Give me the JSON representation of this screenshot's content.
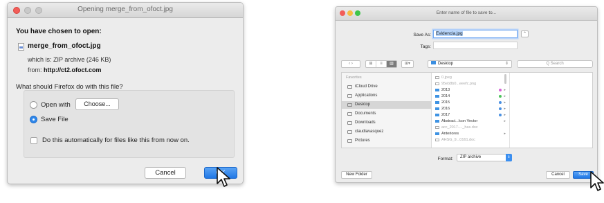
{
  "firefox_dialog": {
    "title": "Opening merge_from_ofoct.jpg",
    "heading": "You have chosen to open:",
    "file_name": "merge_from_ofoct.jpg",
    "which_is": "which is: ZIP archive (246 KB)",
    "from_prefix": "from: ",
    "from_url": "http://ct2.ofoct.com",
    "question": "What should Firefox do with this file?",
    "open_with_label": "Open with",
    "choose_label": "Choose...",
    "save_file_label": "Save File",
    "save_file_selected": true,
    "auto_label": "Do this automatically for files like this from now on.",
    "auto_checked": false,
    "cancel_label": "Cancel",
    "ok_label": "OK"
  },
  "save_dialog": {
    "title": "Enter name of file to save to...",
    "save_as_label": "Save As:",
    "save_as_value": "Evidencia.jpg",
    "tags_label": "Tags:",
    "expand_glyph": "⌃",
    "nav_glyph": "‹ ›",
    "view_glyphs": [
      "⊞",
      "≡",
      "▥"
    ],
    "arrange_glyph": "⊞▾",
    "location": "Desktop",
    "search_placeholder": "Q Search",
    "sidebar_heading": "Favorites",
    "sidebar_items": [
      {
        "label": "iCloud Drive",
        "selected": false
      },
      {
        "label": "Applications",
        "selected": false
      },
      {
        "label": "Desktop",
        "selected": true
      },
      {
        "label": "Documents",
        "selected": false
      },
      {
        "label": "Downloads",
        "selected": false
      },
      {
        "label": "claudiavasquez",
        "selected": false
      },
      {
        "label": "Pictures",
        "selected": false
      }
    ],
    "files": [
      {
        "name": "0.jpeg",
        "kind": "doc",
        "dim": true,
        "tag": "",
        "arrow": false
      },
      {
        "name": "95eb8b0...eeefc.png",
        "kind": "doc",
        "dim": true,
        "tag": "",
        "arrow": false
      },
      {
        "name": "2013",
        "kind": "folder",
        "dim": false,
        "tag": "#d861d8",
        "arrow": true
      },
      {
        "name": "2014",
        "kind": "folder",
        "dim": false,
        "tag": "#4bc25a",
        "arrow": true
      },
      {
        "name": "2015",
        "kind": "folder",
        "dim": false,
        "tag": "#4a90e2",
        "arrow": true
      },
      {
        "name": "2016",
        "kind": "folder",
        "dim": false,
        "tag": "#4a90e2",
        "arrow": true
      },
      {
        "name": "2017",
        "kind": "folder",
        "dim": false,
        "tag": "#4a90e2",
        "arrow": true
      },
      {
        "name": "Abstract...Icon Vector",
        "kind": "folder",
        "dim": false,
        "tag": "",
        "arrow": true
      },
      {
        "name": "acc_2017-..._has.doc",
        "kind": "doc",
        "dim": true,
        "tag": "",
        "arrow": false
      },
      {
        "name": "Anteriores",
        "kind": "folder",
        "dim": false,
        "tag": "",
        "arrow": true
      },
      {
        "name": "AHSG_9...0161.doc",
        "kind": "doc",
        "dim": true,
        "tag": "",
        "arrow": false
      }
    ],
    "format_label": "Format:",
    "format_value": "ZIP archive",
    "new_folder_label": "New Folder",
    "cancel_label": "Cancel",
    "save_label": "Save"
  },
  "colors": {
    "accent_blue": "#2f87ea",
    "close_red": "#f25d58",
    "minimize_yellow": "#f7bd42",
    "zoom_green": "#3ec54a"
  }
}
